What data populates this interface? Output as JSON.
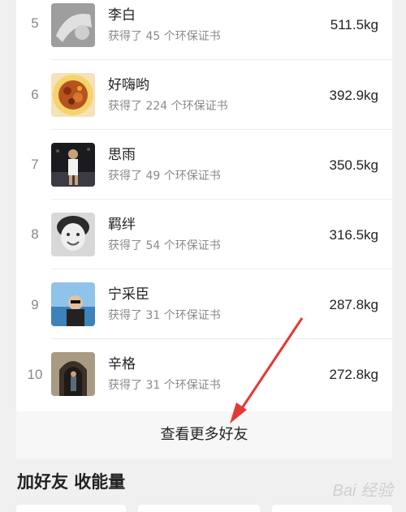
{
  "rows": [
    {
      "rank": "5",
      "name": "李白",
      "certs": "获得了 45 个环保证书",
      "weight": "511.5kg"
    },
    {
      "rank": "6",
      "name": "好嗨哟",
      "certs": "获得了 224 个环保证书",
      "weight": "392.9kg"
    },
    {
      "rank": "7",
      "name": "思雨",
      "certs": "获得了 49 个环保证书",
      "weight": "350.5kg"
    },
    {
      "rank": "8",
      "name": "羁绊",
      "certs": "获得了 54 个环保证书",
      "weight": "316.5kg"
    },
    {
      "rank": "9",
      "name": "宁采臣",
      "certs": "获得了 31 个环保证书",
      "weight": "287.8kg"
    },
    {
      "rank": "10",
      "name": "辛格",
      "certs": "获得了 31 个环保证书",
      "weight": "272.8kg"
    }
  ],
  "more_friends_label": "查看更多好友",
  "section_title": "加好友 收能量",
  "watermark": "Bai 经验",
  "colors": {
    "arrow": "#e53935"
  }
}
